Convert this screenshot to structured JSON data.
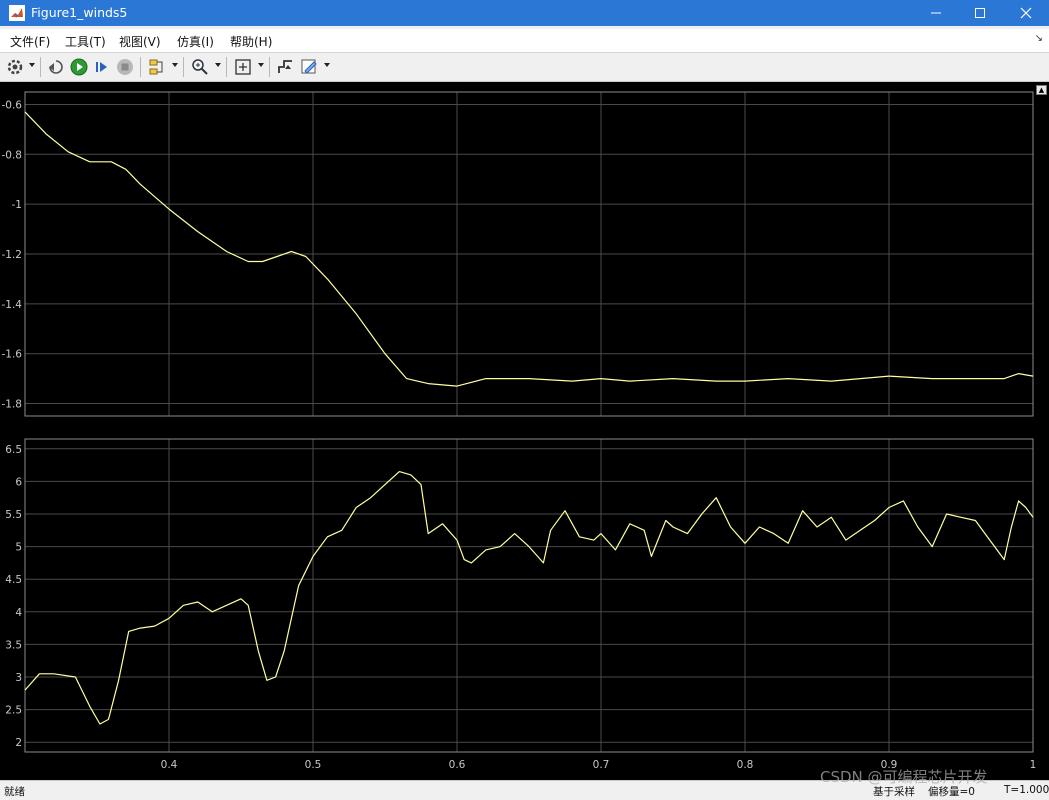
{
  "window": {
    "title": "Figure1_winds5",
    "minimize_icon": "minimize-icon",
    "maximize_icon": "maximize-icon",
    "close_icon": "close-icon"
  },
  "menu": {
    "items": [
      "文件(F)",
      "工具(T)",
      "视图(V)",
      "仿真(I)",
      "帮助(H)"
    ],
    "dock_icon": "dock-arrow-icon"
  },
  "toolbar": {
    "icons": [
      "settings-icon",
      "step-back-icon",
      "run-icon",
      "step-forward-icon",
      "stop-icon",
      "highlight-signal-icon",
      "zoom-icon",
      "fit-to-view-icon",
      "triggers-icon",
      "style-icon"
    ]
  },
  "colors": {
    "plot_background": "#000000",
    "axes_background": "#000000",
    "grid": "#4a4a4a",
    "axis_frame": "#8c8c8c",
    "tick_text": "#c8c8c8",
    "trace": "#ffff9e"
  },
  "status": {
    "left": "就绪",
    "sample": "基于采样",
    "offset": "偏移量=0",
    "time": "T=1.000"
  },
  "watermark": "CSDN @可编程芯片开发",
  "chart_data": [
    {
      "type": "line",
      "title": "",
      "xlabel": "",
      "ylabel": "",
      "xlim": [
        0.3,
        1.0
      ],
      "ylim": [
        -1.85,
        -0.55
      ],
      "xticks": [
        0.4,
        0.5,
        0.6,
        0.7,
        0.8,
        0.9,
        1.0
      ],
      "yticks": [
        -0.6,
        -0.8,
        -1,
        -1.2,
        -1.4,
        -1.6,
        -1.8
      ],
      "ytick_labels": [
        "-0.6",
        "-0.8",
        "-1",
        "-1.2",
        "-1.4",
        "-1.6",
        "-1.8"
      ],
      "grid": true,
      "series": [
        {
          "x": [
            0.3,
            0.315,
            0.33,
            0.345,
            0.36,
            0.37,
            0.38,
            0.4,
            0.42,
            0.44,
            0.455,
            0.465,
            0.475,
            0.485,
            0.495,
            0.51,
            0.53,
            0.55,
            0.565,
            0.58,
            0.6,
            0.62,
            0.65,
            0.68,
            0.7,
            0.72,
            0.75,
            0.78,
            0.8,
            0.83,
            0.86,
            0.88,
            0.9,
            0.93,
            0.96,
            0.98,
            0.99,
            1.0
          ],
          "values": [
            -0.63,
            -0.72,
            -0.79,
            -0.83,
            -0.83,
            -0.86,
            -0.92,
            -1.02,
            -1.11,
            -1.19,
            -1.23,
            -1.23,
            -1.21,
            -1.19,
            -1.21,
            -1.3,
            -1.44,
            -1.6,
            -1.7,
            -1.72,
            -1.73,
            -1.7,
            -1.7,
            -1.71,
            -1.7,
            -1.71,
            -1.7,
            -1.71,
            -1.71,
            -1.7,
            -1.71,
            -1.7,
            -1.69,
            -1.7,
            -1.7,
            -1.7,
            -1.68,
            -1.69
          ]
        }
      ]
    },
    {
      "type": "line",
      "title": "",
      "xlabel": "",
      "ylabel": "",
      "xlim": [
        0.3,
        1.0
      ],
      "ylim": [
        1.85,
        6.65
      ],
      "xticks": [
        0.4,
        0.5,
        0.6,
        0.7,
        0.8,
        0.9,
        1.0
      ],
      "xtick_labels": [
        "0.4",
        "0.5",
        "0.6",
        "0.7",
        "0.8",
        "0.9",
        "1"
      ],
      "yticks": [
        2,
        2.5,
        3,
        3.5,
        4,
        4.5,
        5,
        5.5,
        6,
        6.5
      ],
      "ytick_labels": [
        "2",
        "2.5",
        "3",
        "3.5",
        "4",
        "4.5",
        "5",
        "5.5",
        "6",
        "6.5"
      ],
      "grid": true,
      "series": [
        {
          "x": [
            0.3,
            0.31,
            0.32,
            0.335,
            0.345,
            0.352,
            0.358,
            0.365,
            0.372,
            0.38,
            0.39,
            0.4,
            0.41,
            0.42,
            0.43,
            0.44,
            0.45,
            0.455,
            0.462,
            0.468,
            0.474,
            0.48,
            0.49,
            0.5,
            0.51,
            0.52,
            0.53,
            0.54,
            0.55,
            0.56,
            0.568,
            0.575,
            0.58,
            0.59,
            0.6,
            0.605,
            0.61,
            0.62,
            0.63,
            0.64,
            0.65,
            0.66,
            0.665,
            0.675,
            0.685,
            0.695,
            0.7,
            0.71,
            0.72,
            0.73,
            0.735,
            0.745,
            0.75,
            0.76,
            0.77,
            0.78,
            0.79,
            0.8,
            0.81,
            0.82,
            0.83,
            0.84,
            0.85,
            0.86,
            0.87,
            0.88,
            0.89,
            0.9,
            0.91,
            0.92,
            0.93,
            0.94,
            0.95,
            0.96,
            0.97,
            0.98,
            0.985,
            0.99,
            0.995,
            1.0
          ],
          "values": [
            2.8,
            3.05,
            3.05,
            3.0,
            2.55,
            2.28,
            2.35,
            2.95,
            3.7,
            3.75,
            3.78,
            3.9,
            4.1,
            4.15,
            4.0,
            4.1,
            4.2,
            4.1,
            3.4,
            2.95,
            3.0,
            3.4,
            4.4,
            4.85,
            5.15,
            5.25,
            5.6,
            5.75,
            5.95,
            6.15,
            6.1,
            5.95,
            5.2,
            5.35,
            5.1,
            4.8,
            4.75,
            4.95,
            5.0,
            5.2,
            5.0,
            4.75,
            5.25,
            5.55,
            5.15,
            5.1,
            5.2,
            4.95,
            5.35,
            5.25,
            4.85,
            5.4,
            5.3,
            5.2,
            5.5,
            5.75,
            5.3,
            5.05,
            5.3,
            5.2,
            5.05,
            5.55,
            5.3,
            5.45,
            5.1,
            5.25,
            5.4,
            5.6,
            5.7,
            5.3,
            5.0,
            5.5,
            5.45,
            5.4,
            5.1,
            4.8,
            5.3,
            5.7,
            5.6,
            5.45
          ]
        }
      ]
    }
  ]
}
